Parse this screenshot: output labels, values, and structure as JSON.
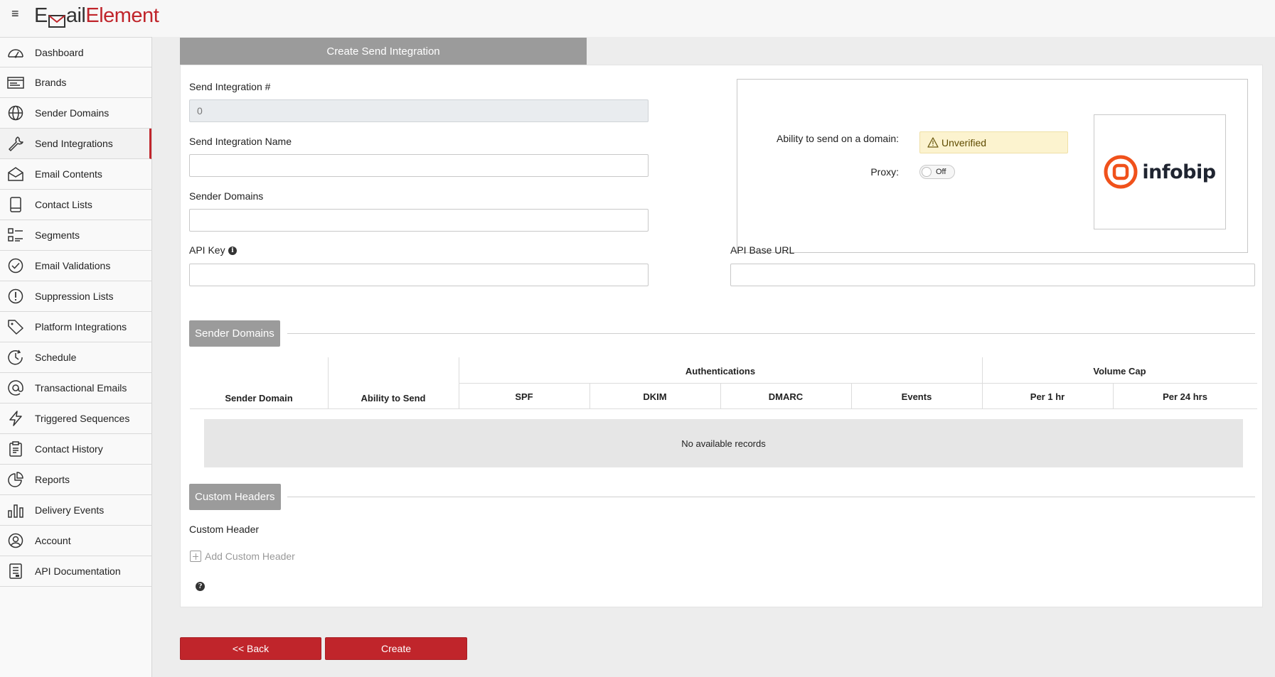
{
  "app": {
    "logo_prefix": "E",
    "logo_mid": "ail",
    "logo_suffix": "Element"
  },
  "sidebar": {
    "items": [
      {
        "label": "Dashboard",
        "icon": "dashboard-icon"
      },
      {
        "label": "Brands",
        "icon": "brands-icon"
      },
      {
        "label": "Sender Domains",
        "icon": "globe-icon"
      },
      {
        "label": "Send Integrations",
        "icon": "wrench-icon",
        "active": true
      },
      {
        "label": "Email Contents",
        "icon": "envelope-open-icon"
      },
      {
        "label": "Contact Lists",
        "icon": "contact-book-icon"
      },
      {
        "label": "Segments",
        "icon": "segments-icon"
      },
      {
        "label": "Email Validations",
        "icon": "check-circle-icon"
      },
      {
        "label": "Suppression Lists",
        "icon": "exclamation-circle-icon"
      },
      {
        "label": "Platform Integrations",
        "icon": "tag-icon"
      },
      {
        "label": "Schedule",
        "icon": "clock-icon"
      },
      {
        "label": "Transactional Emails",
        "icon": "at-sign-icon"
      },
      {
        "label": "Triggered Sequences",
        "icon": "lightning-icon"
      },
      {
        "label": "Contact History",
        "icon": "clipboard-icon"
      },
      {
        "label": "Reports",
        "icon": "pie-chart-icon"
      },
      {
        "label": "Delivery Events",
        "icon": "bar-chart-icon"
      },
      {
        "label": "Account",
        "icon": "user-circle-icon"
      },
      {
        "label": "API Documentation",
        "icon": "document-icon"
      }
    ],
    "active_color": "#c0252b"
  },
  "form": {
    "tab_title": "Create Send Integration",
    "integration_number_label": "Send Integration #",
    "integration_number_value": "0",
    "integration_name_label": "Send Integration Name",
    "integration_name_value": "",
    "sender_domains_label": "Sender Domains",
    "sender_domains_value": "",
    "api_key_label": "API Key",
    "api_key_value": "",
    "api_base_url_label": "API Base URL",
    "api_base_url_value": ""
  },
  "status": {
    "ability_label": "Ability to send on a domain:",
    "ability_value": "Unverified",
    "proxy_label": "Proxy:",
    "proxy_value": "Off",
    "provider_name": "infobip"
  },
  "sender_domains_section": {
    "title": "Sender Domains",
    "columns": {
      "sender_domain": "Sender Domain",
      "ability_to_send": "Ability to Send",
      "authentications": "Authentications",
      "spf": "SPF",
      "dkim": "DKIM",
      "dmarc": "DMARC",
      "events": "Events",
      "volume_cap": "Volume Cap",
      "per_1hr": "Per 1 hr",
      "per_24hrs": "Per 24 hrs"
    },
    "empty_text": "No available records"
  },
  "custom_headers_section": {
    "title": "Custom Headers",
    "label": "Custom Header",
    "add_label": "Add Custom Header"
  },
  "actions": {
    "back_label": "<< Back",
    "create_label": "Create"
  },
  "colors": {
    "brand_red": "#c0252b",
    "section_gray": "#9b9b9b",
    "warning_bg": "#fcf3cf",
    "infobip_orange": "#f0511b"
  }
}
